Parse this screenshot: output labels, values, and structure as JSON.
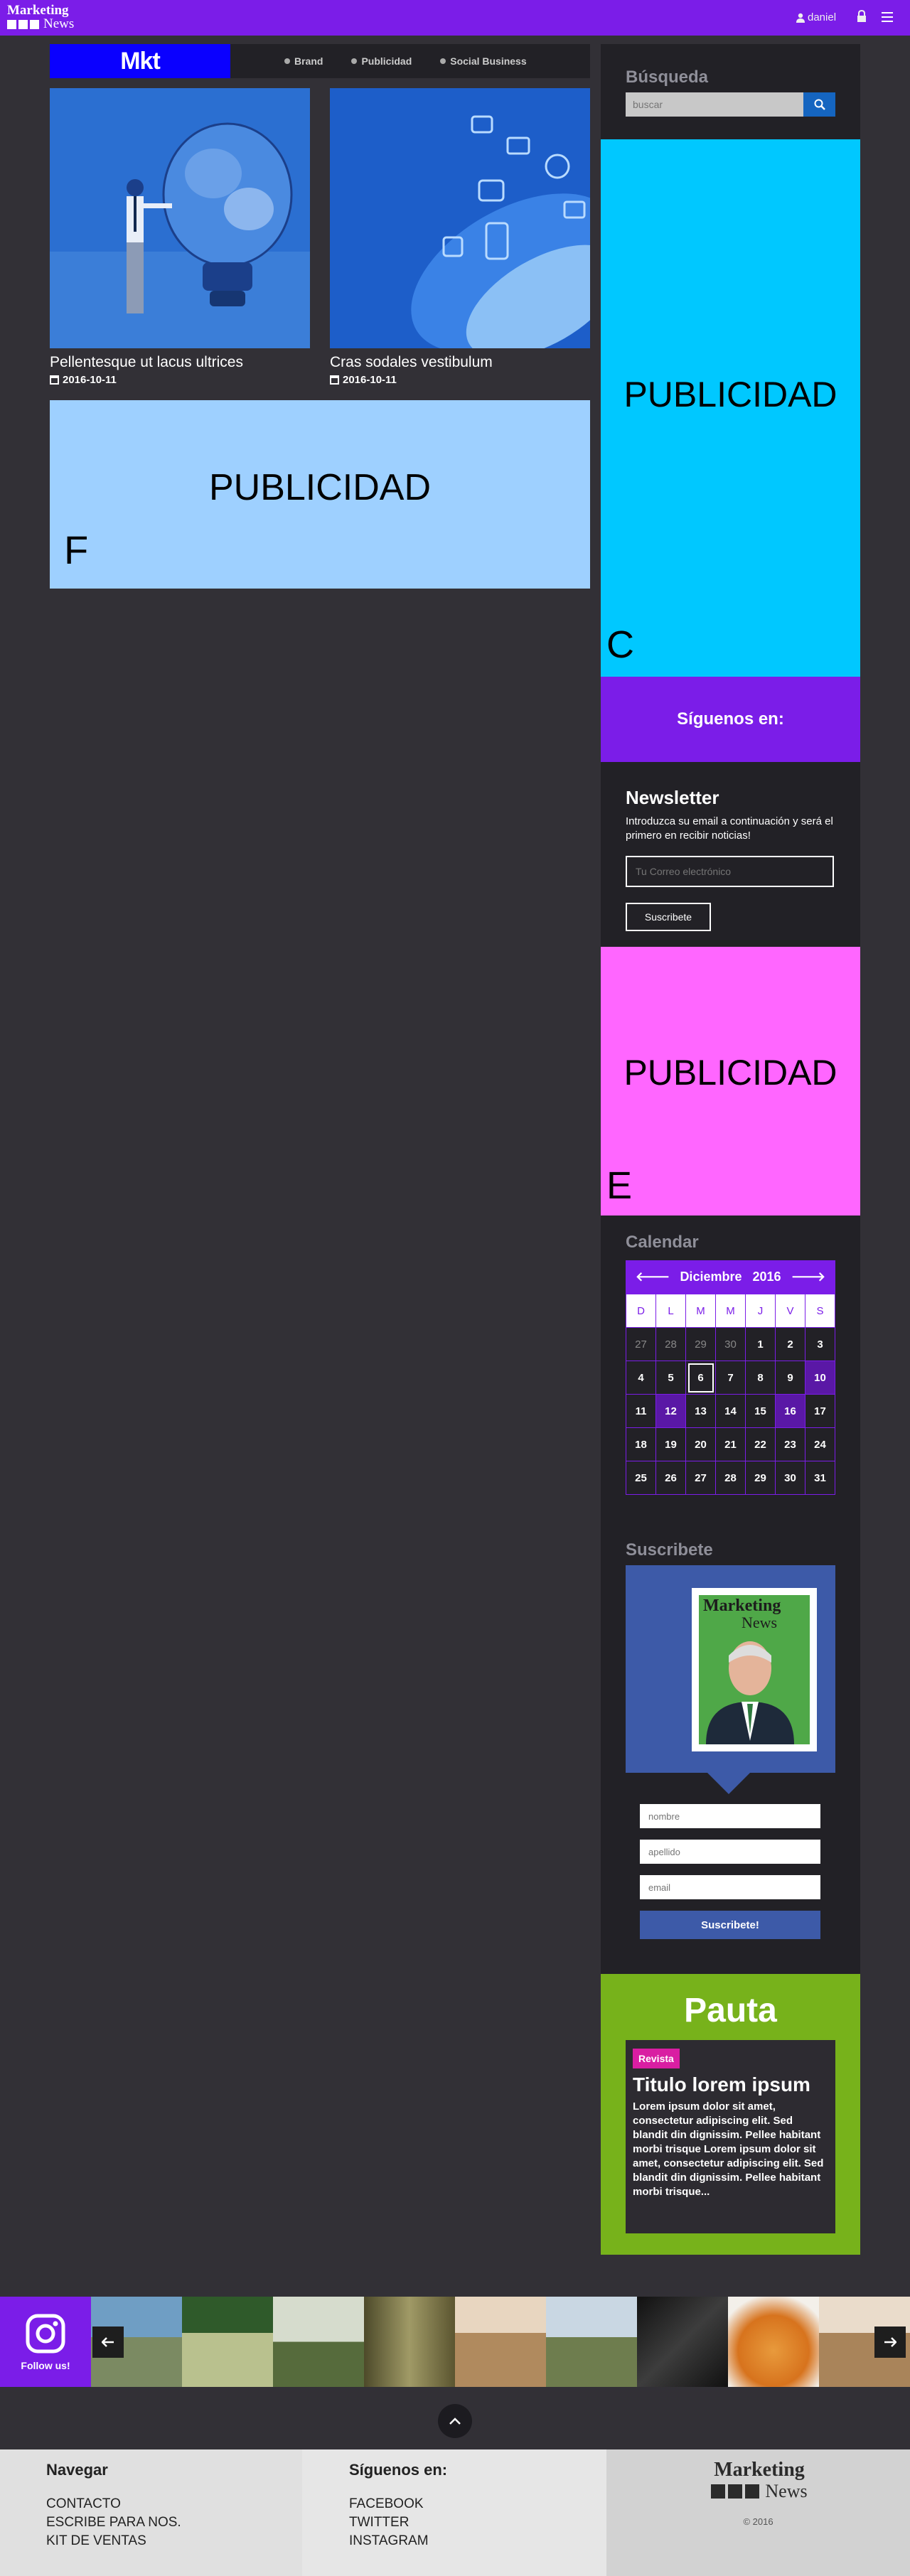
{
  "topbar": {
    "logo_line1": "Marketing",
    "logo_line2": "News",
    "user_name": "daniel",
    "lock_icon": "lock-icon",
    "menu_icon": "hamburger-menu-icon"
  },
  "nav": {
    "brand": "Mkt",
    "items": [
      "Brand",
      "Publicidad",
      "Social Business"
    ]
  },
  "articles": [
    {
      "title": "Pellentesque ut lacus ultrices",
      "date": "2016-10-11"
    },
    {
      "title": "Cras sodales vestibulum",
      "date": "2016-10-11"
    }
  ],
  "ads": {
    "f": {
      "text": "PUBLICIDAD",
      "letter": "F",
      "color": "#9ed0ff"
    },
    "c": {
      "text": "PUBLICIDAD",
      "letter": "C",
      "color": "#00c8ff"
    },
    "e": {
      "text": "PUBLICIDAD",
      "letter": "E",
      "color": "#ff66ff"
    }
  },
  "sidebar": {
    "search_title": "Búsqueda",
    "search_placeholder": "buscar",
    "follow_title": "Síguenos en:",
    "newsletter_title": "Newsletter",
    "newsletter_text": "Introduzca su email a continuación y será el primero en recibir noticias!",
    "newsletter_placeholder": "Tu Correo electrónico",
    "newsletter_button": "Suscribete",
    "calendar_title": "Calendar",
    "subscribe_title": "Suscribete",
    "subscribe_name_ph": "nombre",
    "subscribe_lastname_ph": "apellido",
    "subscribe_email_ph": "email",
    "subscribe_button": "Suscribete!",
    "magazine_title_1": "Marketing",
    "magazine_title_2": "News"
  },
  "calendar": {
    "month": "Diciembre",
    "year": "2016",
    "weekdays": [
      "D",
      "L",
      "M",
      "M",
      "J",
      "V",
      "S"
    ],
    "weeks": [
      [
        "27",
        "28",
        "29",
        "30",
        "1",
        "2",
        "3"
      ],
      [
        "4",
        "5",
        "6",
        "7",
        "8",
        "9",
        "10"
      ],
      [
        "11",
        "12",
        "13",
        "14",
        "15",
        "16",
        "17"
      ],
      [
        "18",
        "19",
        "20",
        "21",
        "22",
        "23",
        "24"
      ],
      [
        "25",
        "26",
        "27",
        "28",
        "29",
        "30",
        "31"
      ]
    ],
    "muted_first_row": 4,
    "highlighted": [
      "10",
      "12",
      "16"
    ],
    "today": "6"
  },
  "pauta": {
    "title": "Pauta",
    "badge": "Revista",
    "heading": "Titulo lorem ipsum",
    "body": "Lorem ipsum dolor sit amet, consectetur adipiscing elit. Sed blandit din dignissim. Pellee habitant morbi trisque Lorem ipsum dolor sit amet, consectetur adipiscing elit. Sed blandit din dignissim. Pellee habitant morbi trisque..."
  },
  "instagram": {
    "follow_label": "Follow us!"
  },
  "footer": {
    "nav_title": "Navegar",
    "nav_links": [
      "CONTACTO",
      "ESCRIBE PARA NOS.",
      "KIT DE VENTAS"
    ],
    "follow_title": "Síguenos en:",
    "follow_links": [
      "FACEBOOK",
      "TWITTER",
      "INSTAGRAM"
    ],
    "logo_line1": "Marketing",
    "logo_line2": "News",
    "copyright": "© 2016"
  }
}
